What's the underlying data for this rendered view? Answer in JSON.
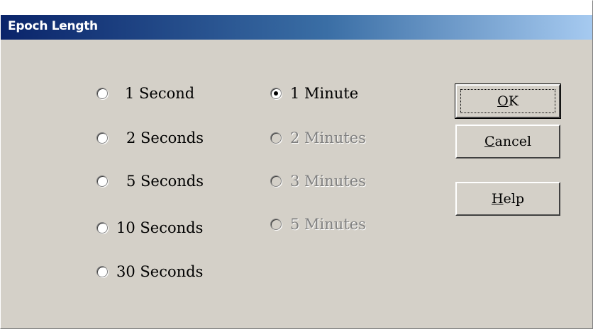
{
  "dialog": {
    "title": "Epoch Length"
  },
  "options": {
    "seconds": [
      {
        "label": "1 Second",
        "checked": false,
        "enabled": true
      },
      {
        "label": "2 Seconds",
        "checked": false,
        "enabled": true
      },
      {
        "label": "5 Seconds",
        "checked": false,
        "enabled": true
      },
      {
        "label": "10 Seconds",
        "checked": false,
        "enabled": true
      },
      {
        "label": "30 Seconds",
        "checked": false,
        "enabled": true
      }
    ],
    "minutes": [
      {
        "label": "1 Minute",
        "checked": true,
        "enabled": true
      },
      {
        "label": "2 Minutes",
        "checked": false,
        "enabled": false
      },
      {
        "label": "3 Minutes",
        "checked": false,
        "enabled": false
      },
      {
        "label": "5 Minutes",
        "checked": false,
        "enabled": false
      }
    ]
  },
  "buttons": {
    "ok": {
      "label": "OK",
      "mnemonic": "O",
      "rest": "K"
    },
    "cancel": {
      "label": "Cancel",
      "mnemonic": "C",
      "rest": "ancel"
    },
    "help": {
      "label": "Help",
      "mnemonic": "H",
      "rest": "elp"
    }
  },
  "colors": {
    "face": "#d4d0c8",
    "title_start": "#0a246a",
    "title_end": "#a6caf0",
    "disabled_text": "#808080"
  }
}
